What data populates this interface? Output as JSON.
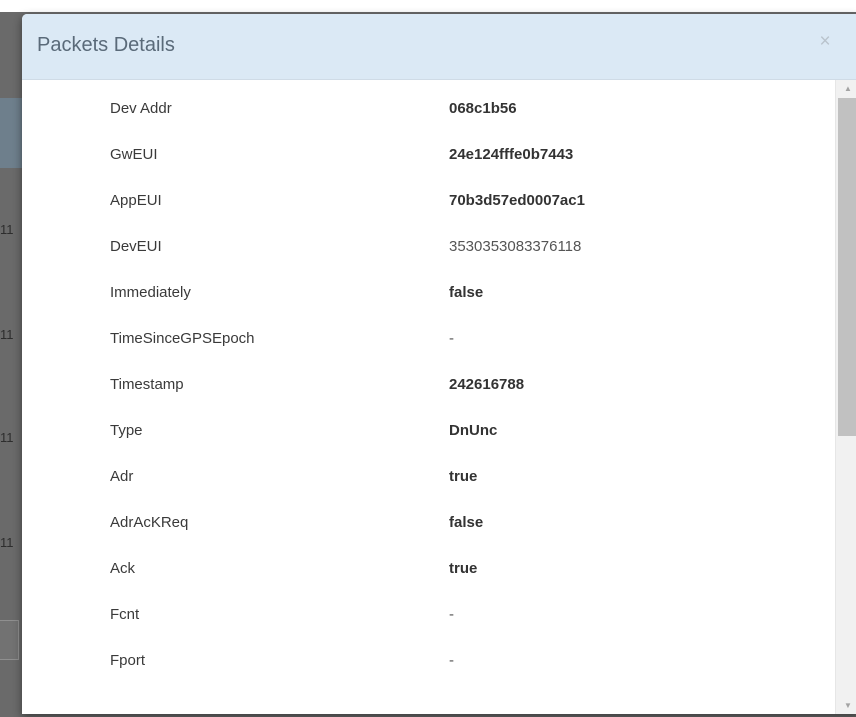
{
  "backdrop": {
    "stubs": [
      "11",
      "11",
      "11",
      "11"
    ]
  },
  "modal": {
    "title": "Packets Details",
    "close_glyph": "×"
  },
  "rows": [
    {
      "label": "Dev Addr",
      "value": "068c1b56"
    },
    {
      "label": "GwEUI",
      "value": "24e124fffe0b7443"
    },
    {
      "label": "AppEUI",
      "value": "70b3d57ed0007ac1"
    },
    {
      "label": "DevEUI",
      "value": "3530353083376118"
    },
    {
      "label": "Immediately",
      "value": "false"
    },
    {
      "label": "TimeSinceGPSEpoch",
      "value": "-"
    },
    {
      "label": "Timestamp",
      "value": "242616788"
    },
    {
      "label": "Type",
      "value": "DnUnc"
    },
    {
      "label": "Adr",
      "value": "true"
    },
    {
      "label": "AdrAcKReq",
      "value": "false"
    },
    {
      "label": "Ack",
      "value": "true"
    },
    {
      "label": "Fcnt",
      "value": "-"
    },
    {
      "label": "Fport",
      "value": "-"
    }
  ],
  "scrollbar": {
    "up_glyph": "▲",
    "down_glyph": "▼"
  }
}
